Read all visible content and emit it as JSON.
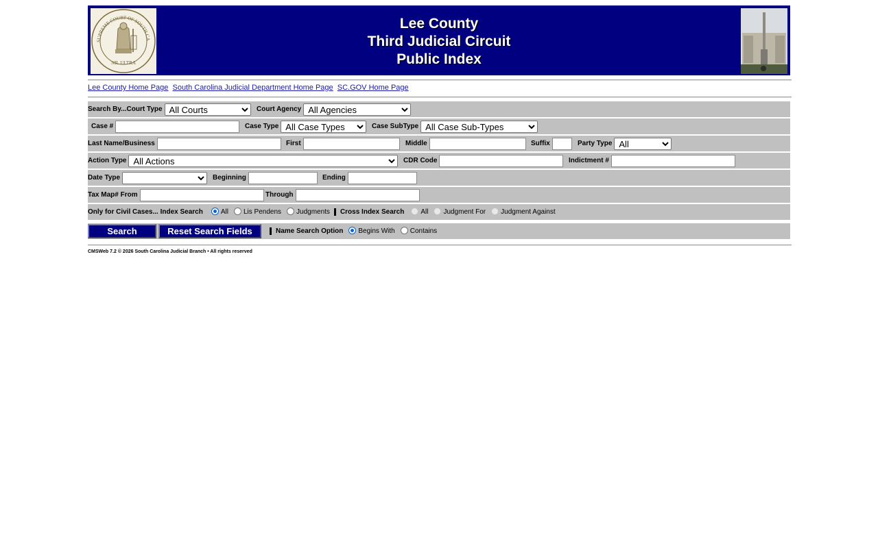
{
  "header": {
    "title_line1": "Lee County",
    "title_line2": "Third Judicial Circuit",
    "title_line3": "Public Index",
    "seal_text_top": "SUPREME COURT OF SOUTH CAROLINA",
    "seal_text_bottom": "NIL ULTRA"
  },
  "links": [
    {
      "label": "Lee County Home Page"
    },
    {
      "label": "South Carolina Judicial Department Home Page"
    },
    {
      "label": "SC.GOV Home Page"
    }
  ],
  "row1": {
    "court_type_label": "Search By...Court Type",
    "court_type_value": "All Courts",
    "court_agency_label": "Court Agency",
    "court_agency_value": "All Agencies"
  },
  "row2": {
    "case_no_label": "Case #",
    "case_no_value": "",
    "case_type_label": "Case Type",
    "case_type_value": "All Case Types",
    "case_subtype_label": "Case SubType",
    "case_subtype_value": "All Case Sub-Types"
  },
  "row3": {
    "last_name_label": "Last Name/Business",
    "first_label": "First",
    "middle_label": "Middle",
    "suffix_label": "Suffix",
    "party_type_label": "Party Type",
    "party_type_value": "All"
  },
  "row4": {
    "action_type_label": "Action Type",
    "action_type_value": "All Actions",
    "cdr_code_label": "CDR Code",
    "indictment_label": "Indictment #"
  },
  "row5": {
    "date_type_label": "Date Type",
    "date_type_value": "",
    "beginning_label": "Beginning",
    "ending_label": "Ending"
  },
  "row6": {
    "tax_map_label": "Tax Map# From",
    "through_label": "Through"
  },
  "row7": {
    "civil_label": "Only for Civil Cases... Index Search",
    "index_options": [
      "All",
      "Lis Pendens",
      "Judgments"
    ],
    "cross_label": "Cross Index Search",
    "cross_options": [
      "All",
      "Judgment For",
      "Judgment Against"
    ]
  },
  "row8": {
    "search_label": "Search",
    "reset_label": "Reset Search Fields",
    "name_option_label": "Name Search Option",
    "name_options": [
      "Begins With",
      "Contains"
    ]
  },
  "footer": {
    "text": "CMSWeb 7.2 © 2026 South Carolina Judicial Branch • All rights reserved"
  },
  "colors": {
    "banner": "#000080",
    "row_bg": "#c0c0c0",
    "link": "#1a1aa6"
  }
}
